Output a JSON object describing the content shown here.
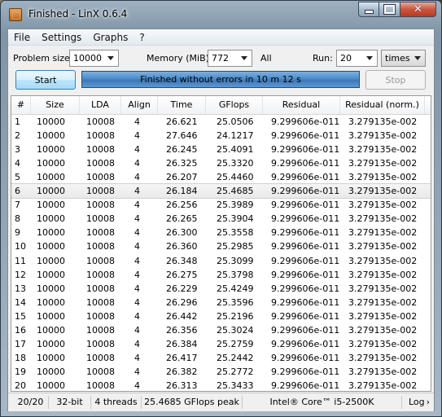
{
  "window": {
    "title": "Finished - LinX 0.6.4"
  },
  "menu": [
    "File",
    "Settings",
    "Graphs",
    "?"
  ],
  "controls": {
    "problem_size_label": "Problem size:",
    "problem_size_value": "10000",
    "memory_label": "Memory (MiB):",
    "memory_value": "772",
    "all_label": "All",
    "run_label": "Run:",
    "run_value": "20",
    "run_unit": "times",
    "start_label": "Start",
    "stop_label": "Stop",
    "progress_text": "Finished without errors in 10 m 12 s",
    "progress_fraction": 1.0
  },
  "table": {
    "columns": [
      "#",
      "Size",
      "LDA",
      "Align",
      "Time",
      "GFlops",
      "Residual",
      "Residual (norm.)"
    ],
    "selected_row": 6,
    "rows": [
      [
        "1",
        "10000",
        "10008",
        "4",
        "26.621",
        "25.0506",
        "9.299606e-011",
        "3.279135e-002"
      ],
      [
        "2",
        "10000",
        "10008",
        "4",
        "27.646",
        "24.1217",
        "9.299606e-011",
        "3.279135e-002"
      ],
      [
        "3",
        "10000",
        "10008",
        "4",
        "26.245",
        "25.4091",
        "9.299606e-011",
        "3.279135e-002"
      ],
      [
        "4",
        "10000",
        "10008",
        "4",
        "26.325",
        "25.3320",
        "9.299606e-011",
        "3.279135e-002"
      ],
      [
        "5",
        "10000",
        "10008",
        "4",
        "26.207",
        "25.4460",
        "9.299606e-011",
        "3.279135e-002"
      ],
      [
        "6",
        "10000",
        "10008",
        "4",
        "26.184",
        "25.4685",
        "9.299606e-011",
        "3.279135e-002"
      ],
      [
        "7",
        "10000",
        "10008",
        "4",
        "26.256",
        "25.3989",
        "9.299606e-011",
        "3.279135e-002"
      ],
      [
        "8",
        "10000",
        "10008",
        "4",
        "26.265",
        "25.3904",
        "9.299606e-011",
        "3.279135e-002"
      ],
      [
        "9",
        "10000",
        "10008",
        "4",
        "26.300",
        "25.3558",
        "9.299606e-011",
        "3.279135e-002"
      ],
      [
        "10",
        "10000",
        "10008",
        "4",
        "26.360",
        "25.2985",
        "9.299606e-011",
        "3.279135e-002"
      ],
      [
        "11",
        "10000",
        "10008",
        "4",
        "26.348",
        "25.3099",
        "9.299606e-011",
        "3.279135e-002"
      ],
      [
        "12",
        "10000",
        "10008",
        "4",
        "26.275",
        "25.3798",
        "9.299606e-011",
        "3.279135e-002"
      ],
      [
        "13",
        "10000",
        "10008",
        "4",
        "26.229",
        "25.4249",
        "9.299606e-011",
        "3.279135e-002"
      ],
      [
        "14",
        "10000",
        "10008",
        "4",
        "26.296",
        "25.3596",
        "9.299606e-011",
        "3.279135e-002"
      ],
      [
        "15",
        "10000",
        "10008",
        "4",
        "26.442",
        "25.2196",
        "9.299606e-011",
        "3.279135e-002"
      ],
      [
        "16",
        "10000",
        "10008",
        "4",
        "26.356",
        "25.3024",
        "9.299606e-011",
        "3.279135e-002"
      ],
      [
        "17",
        "10000",
        "10008",
        "4",
        "26.384",
        "25.2759",
        "9.299606e-011",
        "3.279135e-002"
      ],
      [
        "18",
        "10000",
        "10008",
        "4",
        "26.417",
        "25.2442",
        "9.299606e-011",
        "3.279135e-002"
      ],
      [
        "19",
        "10000",
        "10008",
        "4",
        "26.382",
        "25.2772",
        "9.299606e-011",
        "3.279135e-002"
      ],
      [
        "20",
        "10000",
        "10008",
        "4",
        "26.313",
        "25.3433",
        "9.299606e-011",
        "3.279135e-002"
      ]
    ]
  },
  "status": {
    "progress": "20/20",
    "arch": "32-bit",
    "threads": "4 threads",
    "peak": "25.4685 GFlops peak",
    "cpu": "Intel® Core™ i5-2500K",
    "log_label": "Log"
  },
  "icons": {
    "app": "linx-app-icon",
    "minimize": "minimize-icon",
    "maximize": "maximize-icon",
    "close": "close-icon",
    "dropdown": "chevron-down-icon",
    "log": "chevron-right-icon"
  }
}
